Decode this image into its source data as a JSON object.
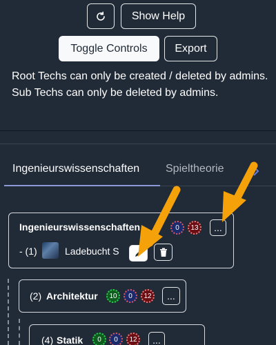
{
  "toolbar": {
    "refresh_icon": "refresh-icon",
    "show_help_label": "Show Help",
    "toggle_controls_label": "Toggle Controls",
    "export_label": "Export"
  },
  "info_text": "Root Techs can only be created / deleted by admins. Sub Techs can only be deleted by admins.",
  "tabs": [
    {
      "label": "Ingenieurswissenschaften",
      "active": true
    },
    {
      "label": "Spieltheorie",
      "active": false
    }
  ],
  "tree": {
    "root": {
      "title": "Ingenieurswissenschaften",
      "badges": [
        "0",
        "13"
      ],
      "more_label": "...",
      "sub_prefix": "- (1)",
      "sub_name": "Ladebucht S"
    },
    "child1": {
      "number": "(2)",
      "title": "Architektur",
      "badges": [
        "10",
        "0",
        "12"
      ],
      "more_label": "..."
    },
    "child2": {
      "number": "(4)",
      "title": "Statik",
      "badges": [
        "0",
        "0",
        "12"
      ],
      "more_label": "..."
    }
  },
  "colors": {
    "background": "#212a37",
    "tab_underline": "#8d99d6",
    "arrow": "#f5a20a"
  }
}
